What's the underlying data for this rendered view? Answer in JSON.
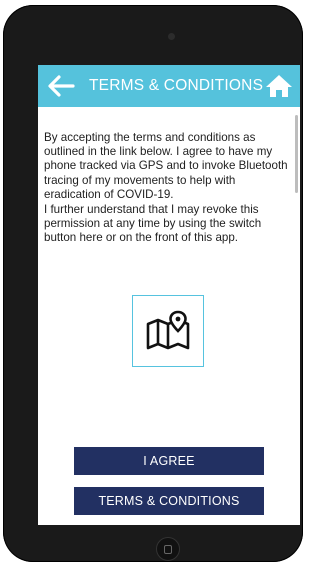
{
  "header": {
    "title": "TERMS & CONDITIONS",
    "back_icon": "arrow-left-icon",
    "home_icon": "home-icon"
  },
  "content": {
    "paragraph1": "By accepting the terms and conditions as outlined in the link below. I agree to have my phone tracked via GPS and to invoke Bluetooth tracing of my movements to help with eradication of COVID-19.",
    "paragraph2": "I further understand that I may revoke this permission at any time by using the switch button here or on the front of this app.",
    "map_icon": "map-pin-icon"
  },
  "buttons": {
    "agree_label": "I AGREE",
    "terms_label": "TERMS & CONDITIONS"
  },
  "colors": {
    "header_bg": "#55c2dc",
    "button_bg": "#223062",
    "icon_border": "#56c3df"
  }
}
